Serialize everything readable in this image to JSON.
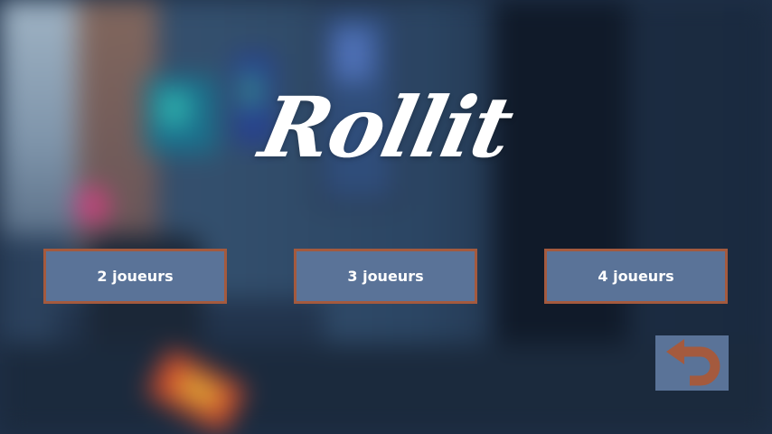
{
  "game": {
    "title": "Rollit"
  },
  "menu": {
    "buttons": [
      {
        "label": "2 joueurs"
      },
      {
        "label": "3 joueurs"
      },
      {
        "label": "4 joueurs"
      }
    ],
    "back_icon": "undo-arrow-icon"
  },
  "colors": {
    "button_fill": "#5a7398",
    "button_border": "#a45a3e",
    "back_arrow": "#a45a3e",
    "title": "#ffffff"
  }
}
